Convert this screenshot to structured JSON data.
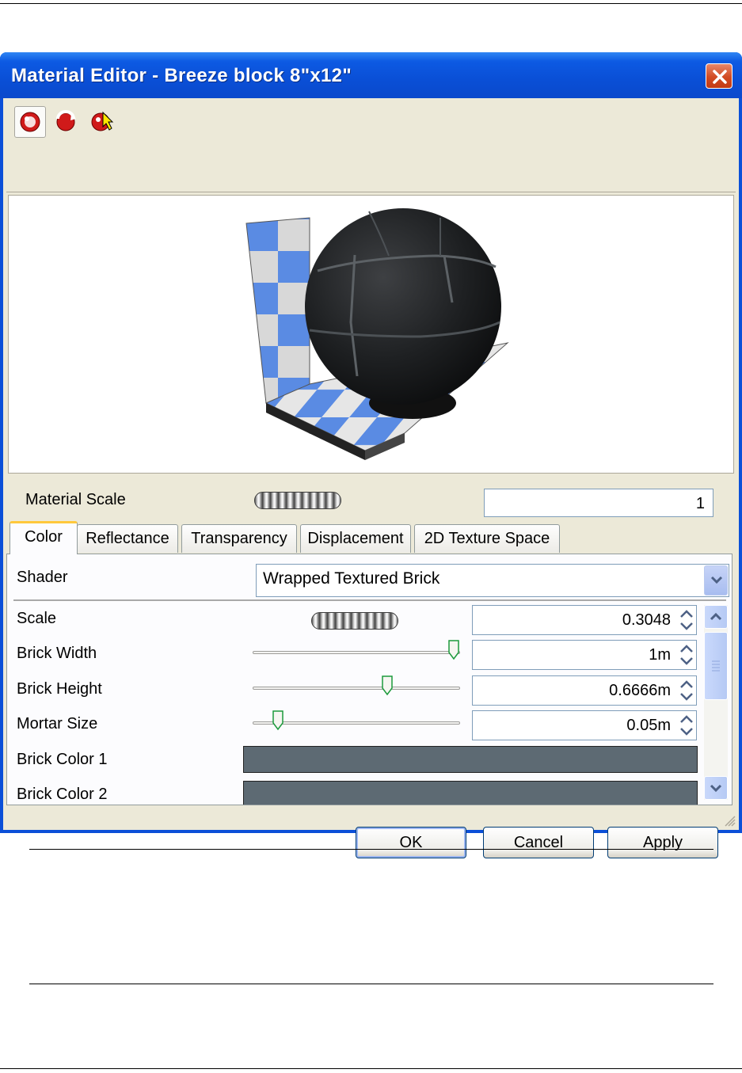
{
  "window": {
    "title": "Material Editor - Breeze block 8\"x12\""
  },
  "toolbar": {
    "buttons": [
      "sphere-material-icon",
      "rotate-material-icon",
      "pick-material-icon"
    ]
  },
  "material_scale": {
    "label": "Material Scale",
    "value": "1"
  },
  "tabs": [
    {
      "label": "Color",
      "active": true
    },
    {
      "label": "Reflectance",
      "active": false
    },
    {
      "label": "Transparency",
      "active": false
    },
    {
      "label": "Displacement",
      "active": false
    },
    {
      "label": "2D Texture Space",
      "active": false
    }
  ],
  "shader": {
    "label": "Shader",
    "value": "Wrapped Textured Brick"
  },
  "params": [
    {
      "label": "Scale",
      "value": "0.3048"
    },
    {
      "label": "Brick Width",
      "value": "1m",
      "slider": 1.0
    },
    {
      "label": "Brick Height",
      "value": "0.6666m",
      "slider": 0.66
    },
    {
      "label": "Mortar Size",
      "value": "0.05m",
      "slider": 0.1
    },
    {
      "label": "Brick Color 1",
      "color": "#5d6a73"
    },
    {
      "label": "Brick Color 2",
      "color": "#5d6a73"
    }
  ],
  "buttons": {
    "ok": "OK",
    "cancel": "Cancel",
    "apply": "Apply"
  },
  "colors": {
    "titlebar": "#0b4fd8",
    "dialog_bg": "#ece9d8",
    "tab_highlight": "#ffc83c",
    "checker_blue": "#5a8be3"
  }
}
